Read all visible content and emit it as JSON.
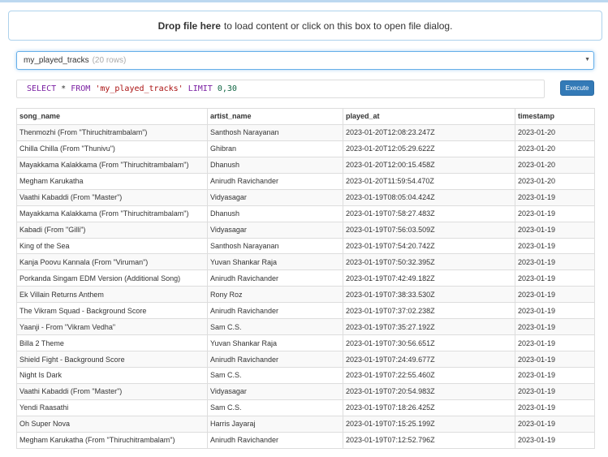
{
  "dropzone": {
    "bold_text": "Drop file here",
    "rest_text": "to load content or click on this box to open file dialog."
  },
  "table_select": {
    "name": "my_played_tracks",
    "rows": "(20 rows)",
    "caret": "▼"
  },
  "query": {
    "kw1": "SELECT",
    "star": " * ",
    "kw2": "FROM",
    "table": "'my_played_tracks'",
    "kw3": "LIMIT",
    "limit": "0,30"
  },
  "execute_label": "Execute",
  "columns": [
    "song_name",
    "artist_name",
    "played_at",
    "timestamp"
  ],
  "rows": [
    [
      "Thenmozhi (From \"Thiruchitrambalam\")",
      "Santhosh Narayanan",
      "2023-01-20T12:08:23.247Z",
      "2023-01-20"
    ],
    [
      "Chilla Chilla (From \"Thunivu\")",
      "Ghibran",
      "2023-01-20T12:05:29.622Z",
      "2023-01-20"
    ],
    [
      "Mayakkama Kalakkama (From \"Thiruchitrambalam\")",
      "Dhanush",
      "2023-01-20T12:00:15.458Z",
      "2023-01-20"
    ],
    [
      "Megham Karukatha",
      "Anirudh Ravichander",
      "2023-01-20T11:59:54.470Z",
      "2023-01-20"
    ],
    [
      "Vaathi Kabaddi (From \"Master\")",
      "Vidyasagar",
      "2023-01-19T08:05:04.424Z",
      "2023-01-19"
    ],
    [
      "Mayakkama Kalakkama (From \"Thiruchitrambalam\")",
      "Dhanush",
      "2023-01-19T07:58:27.483Z",
      "2023-01-19"
    ],
    [
      "Kabadi (From \"Gilli\")",
      "Vidyasagar",
      "2023-01-19T07:56:03.509Z",
      "2023-01-19"
    ],
    [
      "King of the Sea",
      "Santhosh Narayanan",
      "2023-01-19T07:54:20.742Z",
      "2023-01-19"
    ],
    [
      "Kanja Poovu Kannala (From \"Viruman\")",
      "Yuvan Shankar Raja",
      "2023-01-19T07:50:32.395Z",
      "2023-01-19"
    ],
    [
      "Porkanda Singam EDM Version (Additional Song)",
      "Anirudh Ravichander",
      "2023-01-19T07:42:49.182Z",
      "2023-01-19"
    ],
    [
      "Ek Villain Returns Anthem",
      "Rony Roz",
      "2023-01-19T07:38:33.530Z",
      "2023-01-19"
    ],
    [
      "The Vikram Squad - Background Score",
      "Anirudh Ravichander",
      "2023-01-19T07:37:02.238Z",
      "2023-01-19"
    ],
    [
      "Yaanji - From \"Vikram Vedha\"",
      "Sam C.S.",
      "2023-01-19T07:35:27.192Z",
      "2023-01-19"
    ],
    [
      "Billa 2 Theme",
      "Yuvan Shankar Raja",
      "2023-01-19T07:30:56.651Z",
      "2023-01-19"
    ],
    [
      "Shield Fight - Background Score",
      "Anirudh Ravichander",
      "2023-01-19T07:24:49.677Z",
      "2023-01-19"
    ],
    [
      "Night Is Dark",
      "Sam C.S.",
      "2023-01-19T07:22:55.460Z",
      "2023-01-19"
    ],
    [
      "Vaathi Kabaddi (From \"Master\")",
      "Vidyasagar",
      "2023-01-19T07:20:54.983Z",
      "2023-01-19"
    ],
    [
      "Yendi Raasathi",
      "Sam C.S.",
      "2023-01-19T07:18:26.425Z",
      "2023-01-19"
    ],
    [
      "Oh Super Nova",
      "Harris Jayaraj",
      "2023-01-19T07:15:25.199Z",
      "2023-01-19"
    ],
    [
      "Megham Karukatha (From \"Thiruchitrambalam\")",
      "Anirudh Ravichander",
      "2023-01-19T07:12:52.796Z",
      "2023-01-19"
    ]
  ]
}
